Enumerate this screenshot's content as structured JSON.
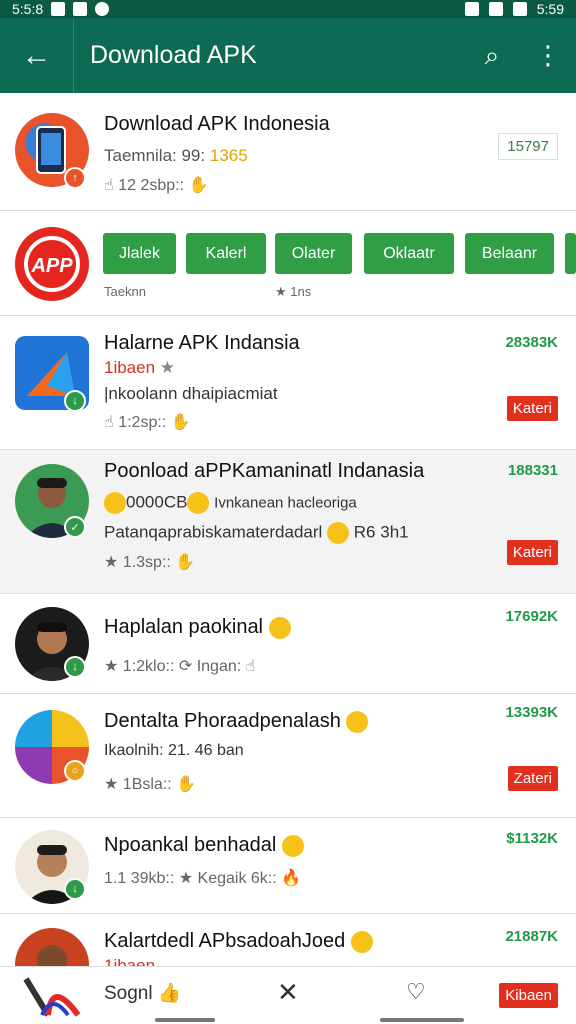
{
  "status": {
    "time_left": "5:5:8",
    "time_right": "5:59"
  },
  "appbar": {
    "back_icon": "←",
    "title": "Download APK",
    "search_icon": "⌕",
    "more_icon": "⋮"
  },
  "item0": {
    "title": "Download APK Indonesia",
    "line2_prefix": "Taemnila:  99:",
    "line2_highlight": "1365",
    "line3": "12 2sbp::",
    "number": "15797"
  },
  "chips": {
    "labels": [
      "Jlalek",
      "Kalerl",
      "Olater",
      "Oklaatr",
      "Belaanr"
    ],
    "sub_left": "Taeknn",
    "sub_right": "1ns"
  },
  "item1": {
    "title": "Halarne APK Indansia",
    "sub_red": "1ibaen",
    "line3": "|nkoolann dhaipiacmiat",
    "line4": "1:2sp::",
    "number": "28383K",
    "button": "Kateri"
  },
  "item2": {
    "title": "Poonload aPPKamaninatl Indanasia",
    "line2a": "0000CB",
    "line2b": "Ivnkanean hacleoriga",
    "line3": "Patanqaprabiskamaterdadarl",
    "line3b": "R6 3h1",
    "line4": "1.3sp::",
    "number": "188331",
    "button": "Kateri"
  },
  "item3": {
    "title": "Haplalan paokinal",
    "line2": "1:2klo::",
    "line2b": "Ingan:",
    "number": "17692K"
  },
  "item4": {
    "title": "Dentalta Phoraadpenalash",
    "line2": "Ikaolnih:  21. 46 ban",
    "line3": "1Bsla::",
    "number": "13393K",
    "button": "Zateri"
  },
  "item5": {
    "title": "Npoankal benhadal",
    "line2": "1.1 39kb::",
    "line2b": "Kegaik 6k::",
    "number": "$1132K"
  },
  "item6": {
    "title": "Kalartdedl APbsadoahJoed",
    "sub_red": "1ibaen",
    "number": "21887K"
  },
  "bottom": {
    "label": "Sognl",
    "close_icon": "✕",
    "button": "Kibaen"
  },
  "colors": {
    "appbar": "#0d6b53",
    "green": "#2f9e44",
    "red": "#e2301f"
  }
}
